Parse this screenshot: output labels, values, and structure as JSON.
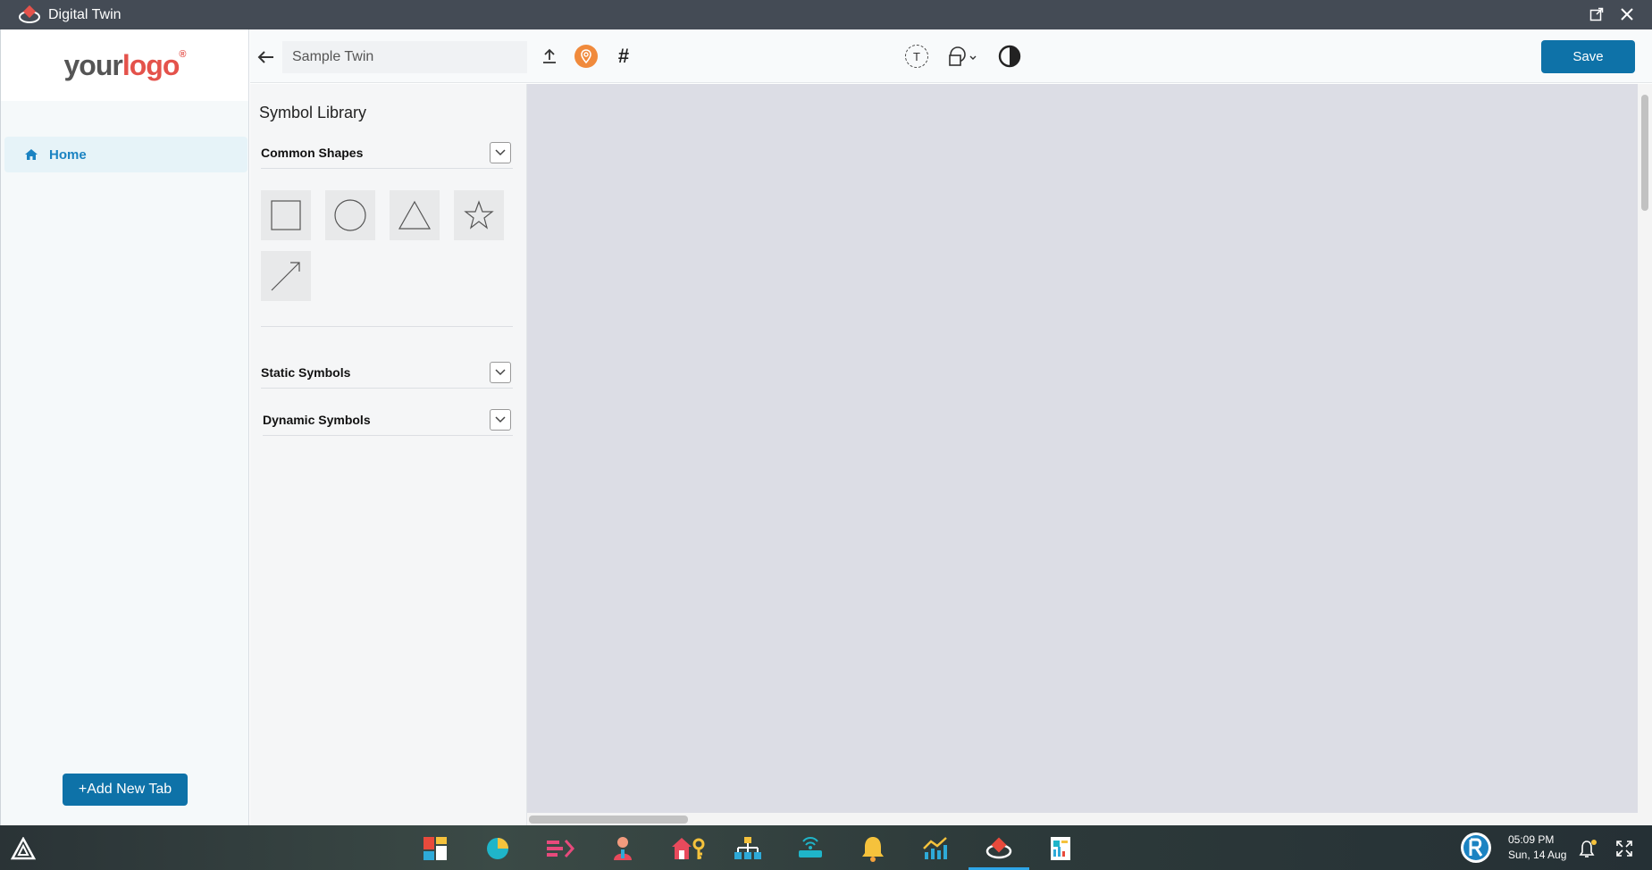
{
  "window": {
    "title": "Digital Twin"
  },
  "logo": {
    "part1": "your",
    "part2": "logo",
    "mark": "®"
  },
  "nav": {
    "home_label": "Home",
    "add_tab_label": "+Add New Tab"
  },
  "toolbar": {
    "twin_name": "Sample Twin",
    "save_label": "Save",
    "text_tool_glyph": "T",
    "grid_glyph": "#"
  },
  "library": {
    "title": "Symbol Library",
    "sections": [
      "Common Shapes",
      "Static Symbols",
      "Dynamic Symbols"
    ],
    "shapes": [
      "square-icon",
      "circle-icon",
      "triangle-icon",
      "star-icon",
      "arrow-icon"
    ]
  },
  "taskbar": {
    "time": "05:09 PM",
    "date": "Sun, 14 Aug"
  },
  "colors": {
    "accent": "#0e72a8",
    "nav_active": "#1b83c2",
    "titlebar": "#444b55",
    "canvas": "#dcdde5",
    "pin": "#f08a3c"
  }
}
